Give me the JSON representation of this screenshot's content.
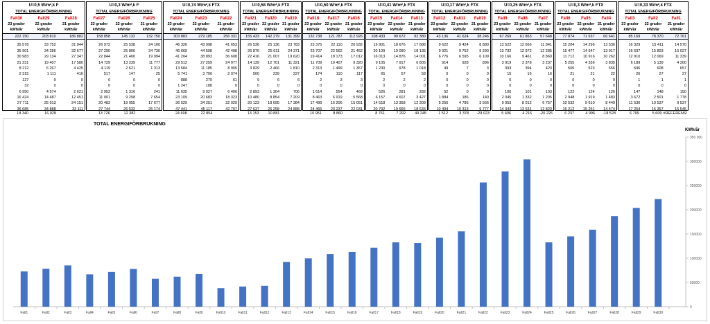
{
  "sheet": {
    "groups": [
      {
        "title_u": "U=0,5 W/m²,k F",
        "title_t": "TOTAL ENERGIFÖRBRUKNING",
        "cols": [
          "Fall30",
          "Fall29",
          "Fall28"
        ],
        "hdr": [
          "23 grader\nkWh/år",
          "22 grader\nkWh/år",
          "21 grader\nkWh/år"
        ],
        "total": [
          "222 150",
          "203 810",
          "186 882"
        ],
        "rows": [
          [
            "35 578",
            "33 752",
            "31 944"
          ],
          [
            "35 901",
            "34 286",
            "32 677"
          ],
          [
            "30 983",
            "29 134",
            "27 347"
          ],
          [
            "21 231",
            "19 407",
            "17 580"
          ],
          [
            "8 212",
            "6 267",
            "4 425"
          ],
          [
            "2 315",
            "1 111",
            "416"
          ],
          [
            "127",
            "9",
            "0"
          ],
          [
            "32",
            "0",
            "0"
          ],
          [
            "6 950",
            "4 574",
            "2 621"
          ],
          [
            "16 424",
            "14 487",
            "12 451"
          ],
          [
            "27 711",
            "25 913",
            "24 151"
          ],
          [
            "36 685",
            "34 888",
            "33 111"
          ]
        ],
        "diffs": [
          "18 340",
          "16 928",
          ""
        ]
      },
      {
        "title_u": "U=0,3 W/m²,k F",
        "title_t": "TOTAL ENERGIFÖRBRUKNING",
        "cols": [
          "Fall27",
          "Fall26",
          "Fall25"
        ],
        "hdr": [
          "23 grader\nkWh/år",
          "22 grader\nkWh/år",
          "21 grader\nkWh/år"
        ],
        "total": [
          "158 858",
          "145 132",
          "132 750"
        ],
        "rows": [
          [
            "26 972",
            "25 538",
            "24 160"
          ],
          [
            "27 290",
            "25 806",
            "24 736"
          ],
          [
            "22 844",
            "21 400",
            "19 994"
          ],
          [
            "14 729",
            "13 239",
            "11 777"
          ],
          [
            "4 119",
            "2 621",
            "1 313"
          ],
          [
            "517",
            "147",
            "25"
          ],
          [
            "6",
            "0",
            "0"
          ],
          [
            "0",
            "0",
            "0"
          ],
          [
            "2 952",
            "1 316",
            "241"
          ],
          [
            "11 001",
            "9 298",
            "7 654"
          ],
          [
            "20 483",
            "19 055",
            "17 677"
          ],
          [
            "27 744",
            "26 532",
            "25 174"
          ]
        ],
        "diffs": [
          "13 726",
          "12 382",
          ""
        ]
      },
      {
        "title_u": "U=0,74 W/m²,k FTX",
        "title_t": "TOTAL ENERGIFÖRBRUKNING",
        "cols": [
          "Fall24",
          "Fall23",
          "Fall22"
        ],
        "hdr": [
          "23 grader\nkWh/år",
          "22 grader\nkWh/år",
          "21 grader\nkWh/år"
        ],
        "total": [
          "303 883",
          "279 185",
          "256 331"
        ],
        "rows": [
          [
            "46 326",
            "43 998",
            "41 653"
          ],
          [
            "46 669",
            "44 598",
            "42 498"
          ],
          [
            "41 204",
            "38 893",
            "36 608"
          ],
          [
            "29 512",
            "27 259",
            "24 977"
          ],
          [
            "13 584",
            "11 185",
            "8 905"
          ],
          [
            "5 741",
            "3 706",
            "2 074"
          ],
          [
            "888",
            "279",
            "61"
          ],
          [
            "1 247",
            "188",
            "0"
          ],
          [
            "11 635",
            "9 027",
            "6 406"
          ],
          [
            "23 109",
            "20 683",
            "18 323"
          ],
          [
            "36 529",
            "34 251",
            "32 029"
          ],
          [
            "47 441",
            "45 117",
            "42 797"
          ]
        ],
        "diffs": [
          "24 698",
          "22 854",
          ""
        ]
      },
      {
        "title_u": "U=0,58 W/m²,k FTX",
        "title_t": "TOTAL ENERGIFÖRBRUKNING",
        "cols": [
          "Fall21",
          "Fall20",
          "Fall19"
        ],
        "hdr": [
          "23 grader\nkWh/år",
          "22 grader\nkWh/år",
          "21 grader\nkWh/år"
        ],
        "total": [
          "155 433",
          "142 279",
          "131 399"
        ],
        "rows": [
          [
            "26 536",
            "25 136",
            "23 783"
          ],
          [
            "26 870",
            "25 611",
            "24 371"
          ],
          [
            "22 416",
            "21 007",
            "19 620"
          ],
          [
            "14 139",
            "12 701",
            "11 321"
          ],
          [
            "3 829",
            "2 466",
            "1 810"
          ],
          [
            "500",
            "239",
            "227"
          ],
          [
            "9",
            "6",
            "6"
          ],
          [
            "0",
            "0",
            "0"
          ],
          [
            "2 893",
            "1 304",
            "706"
          ],
          [
            "10 480",
            "8 854",
            "7 209"
          ],
          [
            "20 123",
            "18 695",
            "17 384"
          ],
          [
            "27 637",
            "26 258",
            "24 888"
          ]
        ],
        "diffs": [
          "13 153",
          "10 881",
          ""
        ]
      },
      {
        "title_u": "U=0,50 W/m²,k FTX",
        "title_t": "TOTAL ENERGIFÖRBRUKNING",
        "cols": [
          "Fall18",
          "Fall17",
          "Fall16"
        ],
        "hdr": [
          "23 grader\nkWh/år",
          "22 grader\nkWh/år",
          "21 grader\nkWh/år"
        ],
        "total": [
          "132 738",
          "121 787",
          "112 926"
        ],
        "rows": [
          [
            "23 375",
            "22 110",
            "20 932"
          ],
          [
            "23 707",
            "22 562",
            "21 452"
          ],
          [
            "19 414",
            "18 173",
            "17 012"
          ],
          [
            "11 709",
            "10 407",
            "9 320"
          ],
          [
            "2 313",
            "1 499",
            "1 367"
          ],
          [
            "174",
            "110",
            "117"
          ],
          [
            "2",
            "3",
            "3"
          ],
          [
            "0",
            "0",
            "0"
          ],
          [
            "1 614",
            "554",
            "469"
          ],
          [
            "8 463",
            "6 919",
            "5 568"
          ],
          [
            "17 499",
            "16 206",
            "15 051"
          ],
          [
            "24 466",
            "23 237",
            "22 031"
          ]
        ],
        "diffs": [
          "10 951",
          "8 860",
          ""
        ]
      },
      {
        "title_u": "U=0,41 W/m²,k FTX",
        "title_t": "TOTAL ENERGIFÖRBRUKNING",
        "cols": [
          "Fall15",
          "Fall14",
          "Fall13"
        ],
        "hdr": [
          "23 grader\nkWh/år",
          "22 grader\nkWh/år",
          "21 grader\nkWh/år"
        ],
        "total": [
          "108 433",
          "99 672",
          "92 380"
        ],
        "rows": [
          [
            "19 901",
            "18 676",
            "17 686"
          ],
          [
            "20 109",
            "19 090",
            "18 135"
          ],
          [
            "16 013",
            "14 876",
            "14 001"
          ],
          [
            "9 105",
            "7 917",
            "6 805"
          ],
          [
            "1 230",
            "978",
            "1 018"
          ],
          [
            "65",
            "57",
            "58"
          ],
          [
            "2",
            "2",
            "2"
          ],
          [
            "0",
            "0",
            "0"
          ],
          [
            "526",
            "281",
            "282"
          ],
          [
            "6 157",
            "4 607",
            "3 427"
          ],
          [
            "14 518",
            "13 358",
            "12 309"
          ],
          [
            "20 792",
            "19 665",
            "18 633"
          ]
        ],
        "diffs": [
          "8 761",
          "7 292",
          "49 245"
        ]
      },
      {
        "title_u": "U=0,17 W/m²,k FTX",
        "title_t": "TOTAL ENERGIFÖRBRUKNING",
        "cols": [
          "Fall12",
          "Fall11",
          "Fall10"
        ],
        "hdr": [
          "23 grader\nkWh/år",
          "22 grader\nkWh/år",
          "21 grader\nkWh/år"
        ],
        "total": [
          "43 136",
          "41 624",
          "38 246"
        ],
        "rows": [
          [
            "9 622",
            "9 424",
            "8 880"
          ],
          [
            "9 921",
            "9 752",
            "9 290"
          ],
          [
            "6 776",
            "6 595",
            "6 109"
          ],
          [
            "914",
            "928",
            "896"
          ],
          [
            "49",
            "7",
            "3"
          ],
          [
            "0",
            "0",
            "0"
          ],
          [
            "0",
            "0",
            "0"
          ],
          [
            "0",
            "0",
            "0"
          ],
          [
            "52",
            "0",
            "0"
          ],
          [
            "1 884",
            "186",
            "140"
          ],
          [
            "5 256",
            "4 786",
            "3 566"
          ],
          [
            "10 494",
            "10 313",
            "9 777"
          ]
        ],
        "diffs": [
          "1 512",
          "3 378",
          "-29 023"
        ]
      },
      {
        "title_u": "U=0,25 W/m²,k FTX",
        "title_t": "TOTAL ENERGIFÖRBRUKNING",
        "cols": [
          "Fall9",
          "Fall8",
          "Fall7"
        ],
        "hdr": [
          "23 grader\nkWh/år",
          "22 grader\nkWh/år",
          "21 grader\nkWh/år"
        ],
        "total": [
          "67 269",
          "61 863",
          "57 648"
        ],
        "rows": [
          [
            "13 522",
            "12 666",
            "11 941"
          ],
          [
            "13 732",
            "12 972",
            "12 285"
          ],
          [
            "10 166",
            "9 461",
            "8 860"
          ],
          [
            "3 919",
            "3 378",
            "3 237"
          ],
          [
            "393",
            "394",
            "423"
          ],
          [
            "15",
            "16",
            "16"
          ],
          [
            "0",
            "0",
            "0"
          ],
          [
            "0",
            "0",
            "0"
          ],
          [
            "100",
            "101",
            "103"
          ],
          [
            "2 045",
            "1 332",
            "1 205"
          ],
          [
            "9 053",
            "8 012",
            "6 757"
          ],
          [
            "14 343",
            "13 531",
            "12 820"
          ]
        ],
        "diffs": [
          "5 406",
          "4 216",
          "-20 226"
        ]
      },
      {
        "title_u": "U=0,3 W/m²,k FTX",
        "title_t": "TOTAL ENERGIFÖRBRUKNING",
        "cols": [
          "Fall6",
          "Fall5",
          "Fall4"
        ],
        "hdr": [
          "23 grader\nkWh/år",
          "22 grader\nkWh/år",
          "21 grader\nkWh/år"
        ],
        "total": [
          "77 874",
          "71 637",
          "66 641"
        ],
        "rows": [
          [
            "15 204",
            "14 296",
            "13 536"
          ],
          [
            "15 477",
            "14 647",
            "13 917"
          ],
          [
            "11 712",
            "10 916",
            "10 262"
          ],
          [
            "5 255",
            "4 336",
            "3 835"
          ],
          [
            "500",
            "523",
            "556"
          ],
          [
            "21",
            "21",
            "22"
          ],
          [
            "0",
            "0",
            "0"
          ],
          [
            "0",
            "0",
            "0"
          ],
          [
            "122",
            "124",
            "126"
          ],
          [
            "2 948",
            "1 919",
            "1 483"
          ],
          [
            "10 532",
            "9 610",
            "8 449"
          ],
          [
            "16 212",
            "15 251",
            "14 474"
          ]
        ],
        "diffs": [
          "6 237",
          "4 996",
          "-18 528"
        ]
      },
      {
        "title_u": "U=0,33 W/m²,k FTX",
        "title_t": "TOTAL ENERGIFÖRBRUKNING",
        "cols": [
          "Fall3",
          "Fall2",
          "Fall1"
        ],
        "hdr": [
          "23 grader\nkWh/år",
          "22 grader\nkWh/år",
          "21 grader\nkWh/år"
        ],
        "total": [
          "85 169",
          "78 370",
          "72 761"
        ],
        "rows": [
          [
            "16 329",
            "15 411",
            "14 570"
          ],
          [
            "16 637",
            "15 803",
            "15 027"
          ],
          [
            "12 910",
            "12 069",
            "11 339"
          ],
          [
            "6 189",
            "5 139",
            "4 300"
          ],
          [
            "596",
            "608",
            "657"
          ],
          [
            "26",
            "27",
            "27"
          ],
          [
            "1",
            "1",
            "1"
          ],
          [
            "0",
            "0",
            "0"
          ],
          [
            "147",
            "148",
            "150"
          ],
          [
            "3 672",
            "2 501",
            "1 778"
          ],
          [
            "11 530",
            "10 537",
            "9 537"
          ],
          [
            "17 254",
            "16 357",
            "15 545"
          ]
        ],
        "diffs": [
          "6 799",
          "5 609",
          "#REFERENS!"
        ]
      }
    ]
  },
  "chart_data": {
    "type": "bar",
    "title": "TOTAL ENERGIFÖRBRUKNING",
    "ylabel": "KWh/år",
    "ylim": [
      0,
      350000
    ],
    "yticks": [
      0,
      50000,
      100000,
      150000,
      200000,
      250000,
      300000,
      350000
    ],
    "ytick_labels": [
      "0",
      "50000",
      "100000",
      "150000",
      "200000",
      "250000",
      "300000",
      "350 000"
    ],
    "color": "#4472c4",
    "grid": false,
    "categories": [
      "Fall1",
      "Fall2",
      "Fall3",
      "Fall4",
      "Fall5",
      "Fall6",
      "Fall7",
      "Fall8",
      "Fall9",
      "Fall10",
      "Fall11",
      "Fall12",
      "Fall13",
      "Fall14",
      "Fall15",
      "Fall16",
      "Fall17",
      "Fall18",
      "Fall19",
      "Fall20",
      "Fall21",
      "Fall22",
      "Fall23",
      "Fall24",
      "Fall25",
      "Fall26",
      "Fall27",
      "Fall28",
      "Fall29",
      "Fall30"
    ],
    "values": [
      72761,
      78370,
      85169,
      66641,
      71637,
      77874,
      57648,
      61863,
      67269,
      38246,
      41624,
      43136,
      92380,
      99672,
      108433,
      112926,
      121787,
      132738,
      131399,
      142279,
      155433,
      256331,
      279185,
      303883,
      132750,
      145132,
      158858,
      186882,
      203810,
      222150
    ]
  }
}
